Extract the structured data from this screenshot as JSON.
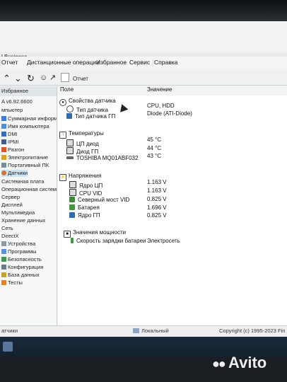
{
  "window": {
    "title": "l Business"
  },
  "menu": {
    "items": [
      "Отчет",
      "Дистанционные операции",
      "Избранное",
      "Сервис",
      "Справка"
    ]
  },
  "toolbar": {
    "icons": [
      "chevron-up-icon",
      "chevron-down-icon",
      "refresh-icon",
      "user-icon",
      "chart-icon"
    ]
  },
  "report_tab": {
    "label": "Отчет"
  },
  "sidebar": {
    "header": "Избранное",
    "items": [
      "A v6.92.6600",
      "мпьютер",
      "Суммарная информа",
      "Имя компьютера",
      "DMI",
      "IPMI",
      "Разгон",
      "Электропитание",
      "Портативный ПК",
      "Датчики",
      "Системная плата",
      "Операционная система",
      "Сервер",
      "Дисплей",
      "Мультимедиа",
      "Хранение данных",
      "Сеть",
      "DirectX",
      "Устройства",
      "Программы",
      "Безопасность",
      "Конфигурация",
      "База данных",
      "Тесты"
    ]
  },
  "columns": {
    "field": "Поле",
    "value": "Значение"
  },
  "groups": [
    {
      "title": "Свойства датчика",
      "rows": [
        {
          "label": "Тип датчика",
          "value": "CPU, HDD"
        },
        {
          "label": "Тип датчика ГП",
          "value": "Diode  (ATI-Diode)"
        }
      ]
    },
    {
      "title": "Температуры",
      "rows": [
        {
          "label": "ЦП диод",
          "value": "45 °C"
        },
        {
          "label": "Диод ГП",
          "value": "44 °C"
        },
        {
          "label": "TOSHIBA MQ01ABF032",
          "value": "43 °C"
        }
      ]
    },
    {
      "title": "Напряжения",
      "rows": [
        {
          "label": "Ядро ЦП",
          "value": "1.163 V"
        },
        {
          "label": "CPU VID",
          "value": "1.163 V"
        },
        {
          "label": "Северный мост VID",
          "value": "0.825 V"
        },
        {
          "label": "Батарея",
          "value": "1.696 V"
        },
        {
          "label": "Ядро ГП",
          "value": "0.825 V"
        }
      ]
    },
    {
      "title": "Значения мощности",
      "rows": [
        {
          "label": "Скорость зарядки батареи",
          "value": "Электросеть"
        }
      ]
    }
  ],
  "statusbar": {
    "left": "атчики",
    "middle": "Локальный",
    "right": "Copyright (c) 1995-2023 Fin"
  },
  "watermark": "Avito",
  "colors": {
    "sidebar_selection": "#cde4f5",
    "taskbar": "#16263a"
  }
}
